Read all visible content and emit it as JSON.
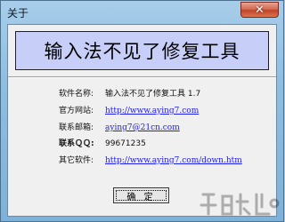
{
  "window": {
    "title": "关于",
    "close_glyph": "✕"
  },
  "banner": {
    "title": "输入法不见了修复工具"
  },
  "info": {
    "software_name_label": "软件名称:",
    "software_name_value": "输入法不见了修复工具 1.7",
    "website_label": "官方网站:",
    "website_value": "http://www.aying7.com",
    "email_label": "联系邮箱:",
    "email_value": "aying7@21cn.com",
    "qq_label": "联系ＱＱ:",
    "qq_value": "99671235",
    "other_software_label": "其它软件:",
    "other_software_value": "http://www.aying7.com/down.htm"
  },
  "buttons": {
    "ok_label": "确 定"
  },
  "colors": {
    "banner_bg": "#c7cef7",
    "link": "#1d1df0",
    "close_red": "#c2432a"
  }
}
